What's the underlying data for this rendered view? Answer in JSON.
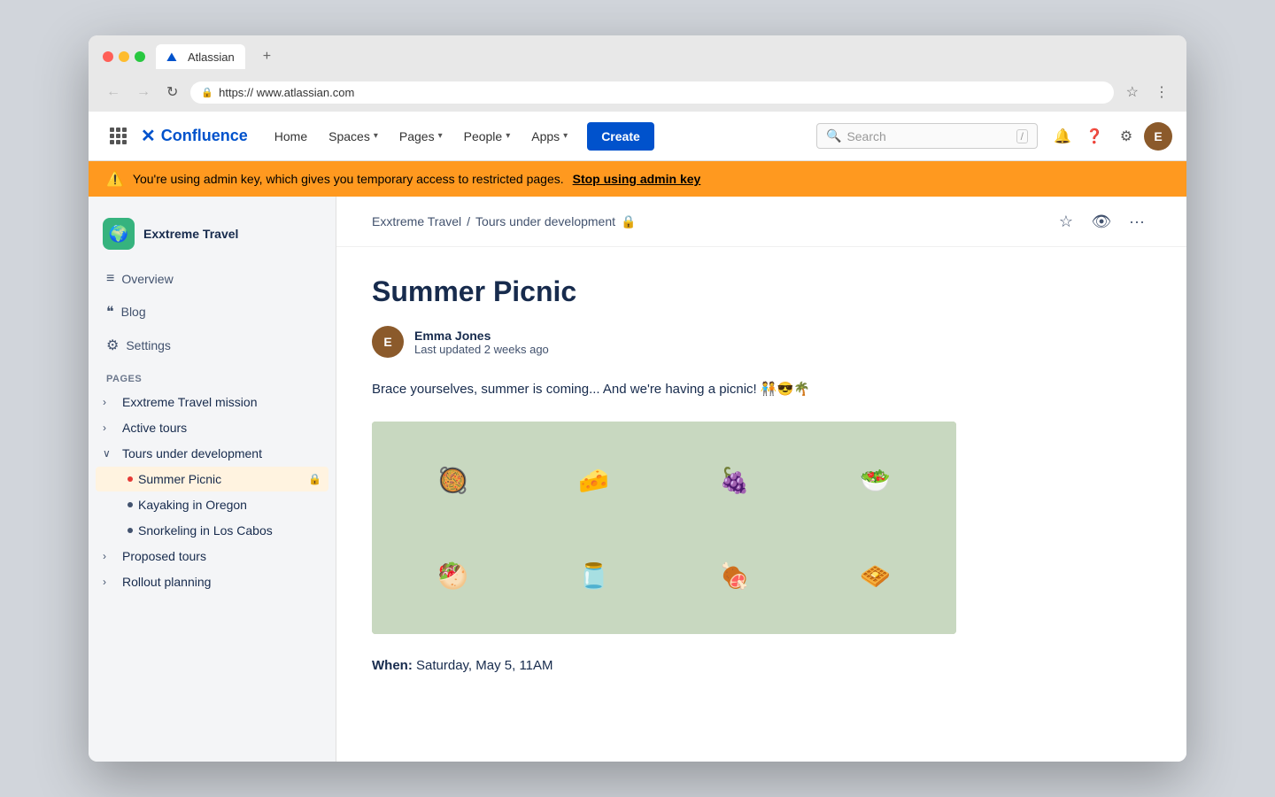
{
  "browser": {
    "tab_label": "Atlassian",
    "tab_plus": "+",
    "url": "https:// www.atlassian.com",
    "nav_back": "←",
    "nav_forward": "→",
    "nav_reload": "↻",
    "star": "☆",
    "more": "⋮"
  },
  "topnav": {
    "logo_text": "Confluence",
    "home": "Home",
    "spaces": "Spaces",
    "pages": "Pages",
    "people": "People",
    "apps": "Apps",
    "create": "Create",
    "search_placeholder": "Search",
    "search_shortcut": "/"
  },
  "warning": {
    "text": "You're using admin key, which gives you temporary access to restricted pages.",
    "link_text": "Stop using admin key"
  },
  "sidebar": {
    "space_icon": "🌍",
    "space_name": "Exxtreme Travel",
    "nav": [
      {
        "icon": "≡",
        "label": "Overview"
      },
      {
        "icon": "❝",
        "label": "Blog"
      },
      {
        "icon": "⚙",
        "label": "Settings"
      }
    ],
    "pages_label": "PAGES",
    "pages": [
      {
        "label": "Exxtreme Travel mission",
        "expanded": false,
        "indent": 0
      },
      {
        "label": "Active tours",
        "expanded": false,
        "indent": 0
      },
      {
        "label": "Tours under development",
        "expanded": true,
        "indent": 0
      },
      {
        "label": "Summer Picnic",
        "active": true,
        "lock": true,
        "indent": 1
      },
      {
        "label": "Kayaking in Oregon",
        "indent": 1
      },
      {
        "label": "Snorkeling in Los Cabos",
        "indent": 1
      },
      {
        "label": "Proposed tours",
        "expanded": false,
        "indent": 0
      },
      {
        "label": "Rollout planning",
        "expanded": false,
        "indent": 0
      }
    ]
  },
  "breadcrumb": {
    "items": [
      "Exxtreme Travel",
      "Tours under development"
    ]
  },
  "page": {
    "title": "Summer Picnic",
    "author_name": "Emma Jones",
    "author_time": "Last updated 2 weeks ago",
    "intro": "Brace yourselves, summer is coming... And we're having a picnic! 🧑‍🤝‍🧑😎🌴",
    "when_label": "When:",
    "when_value": "Saturday, May 5, 11AM",
    "food_items": [
      "🥘",
      "🥗",
      "🍇",
      "🧀",
      "🥙",
      "🫙",
      "🍖",
      "🧇"
    ]
  },
  "colors": {
    "primary": "#0052cc",
    "warning_bg": "#ff991f",
    "sidebar_bg": "#f4f5f7",
    "lock_red": "#e53935",
    "active_page_color": "#0052cc"
  }
}
